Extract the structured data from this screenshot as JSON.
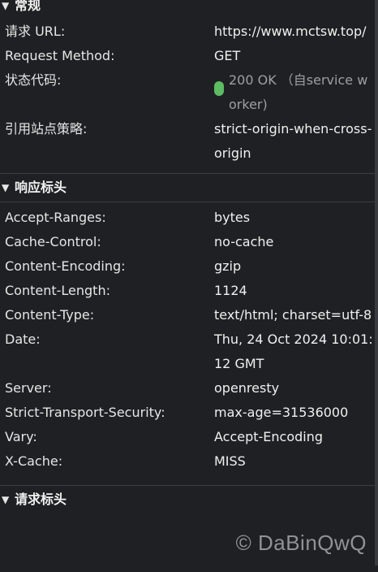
{
  "general": {
    "title": "常规",
    "rows": [
      {
        "label": "请求 URL:",
        "value": "https://www.mctsw.top/"
      },
      {
        "label": "Request Method:",
        "value": "GET"
      },
      {
        "label": "状态代码:",
        "value": "200 OK （自service worker)"
      },
      {
        "label": "引用站点策略:",
        "value": "strict-origin-when-cross-origin"
      }
    ]
  },
  "response_headers": {
    "title": "响应标头",
    "rows": [
      {
        "label": "Accept-Ranges:",
        "value": "bytes"
      },
      {
        "label": "Cache-Control:",
        "value": "no-cache"
      },
      {
        "label": "Content-Encoding:",
        "value": "gzip"
      },
      {
        "label": "Content-Length:",
        "value": "1124"
      },
      {
        "label": "Content-Type:",
        "value": "text/html; charset=utf-8"
      },
      {
        "label": "Date:",
        "value": "Thu, 24 Oct 2024 10:01:12 GMT"
      },
      {
        "label": "Server:",
        "value": "openresty"
      },
      {
        "label": "Strict-Transport-Security:",
        "value": "max-age=31536000"
      },
      {
        "label": "Vary:",
        "value": "Accept-Encoding"
      },
      {
        "label": "X-Cache:",
        "value": "MISS"
      }
    ]
  },
  "request_headers": {
    "title": "请求标头"
  },
  "watermark": "© DaBinQwQ",
  "colors": {
    "status_ok": "#5dbb63",
    "background": "#1f2023"
  },
  "icons": {
    "section_toggle": "caret-down-icon",
    "status": "status-dot-icon"
  }
}
